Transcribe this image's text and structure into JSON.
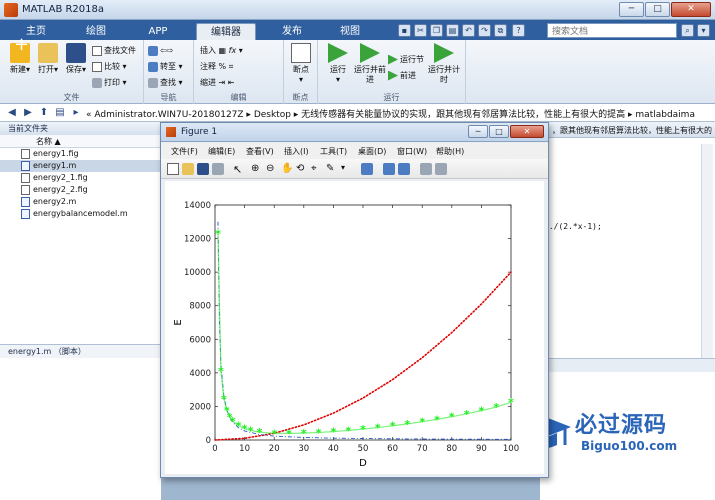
{
  "window": {
    "title": "MATLAB R2018a",
    "controls": {
      "minimize": "─",
      "maximize": "□",
      "close": "✕"
    }
  },
  "ribbon_tabs": [
    "主页",
    "绘图",
    "APP",
    "编辑器",
    "发布",
    "视图"
  ],
  "search": {
    "placeholder": "搜索文档"
  },
  "ribbon": {
    "file_group": {
      "label": "文件",
      "new": "新建",
      "open": "打开",
      "save": "保存",
      "find_files": "查找文件",
      "compare": "比较",
      "print": "打印"
    },
    "nav_group": {
      "label": "导航",
      "goto": "转至",
      "find": "查找"
    },
    "edit_group": {
      "label": "编辑",
      "insert": "插入",
      "comment": "注释",
      "indent": "缩进"
    },
    "breakpoints_group": {
      "label": "断点",
      "breakpoints": "断点"
    },
    "run_group": {
      "label": "运行",
      "run": "运行",
      "run_advance": "运行并前进",
      "run_section": "运行节",
      "advance": "前进",
      "run_time": "运行并计时"
    }
  },
  "address_bar": {
    "path": "«  Administrator.WIN7U-20180127Z  ▸  Desktop  ▸  无线传感器有关能量协议的实现，跟其他现有邻居算法比较，性能上有很大的提高  ▸  matlabdaima"
  },
  "current_folder": {
    "title": "当前文件夹",
    "column_name": "名称 ▲",
    "files": [
      {
        "name": "energy1.fig",
        "type": "fig",
        "selected": false
      },
      {
        "name": "energy1.m",
        "type": "m",
        "selected": true
      },
      {
        "name": "energy2_1.fig",
        "type": "fig",
        "selected": false
      },
      {
        "name": "energy2_2.fig",
        "type": "fig",
        "selected": false
      },
      {
        "name": "energy2.m",
        "type": "m",
        "selected": false
      },
      {
        "name": "energybalancemodel.m",
        "type": "m",
        "selected": false
      }
    ],
    "details_label": "energy1.m  （脚本）"
  },
  "editor": {
    "tab_text": "，跟其他现有邻居算法比较，性能上有很大的",
    "code_fragment": ")./(2.*x-1);"
  },
  "watermark": {
    "title": "必过源码",
    "subtitle": "Biguo100.com"
  },
  "figure": {
    "title": "Figure 1",
    "menus": [
      "文件(F)",
      "编辑(E)",
      "查看(V)",
      "插入(I)",
      "工具(T)",
      "桌面(D)",
      "窗口(W)",
      "帮助(H)"
    ]
  },
  "chart_data": {
    "type": "line",
    "title": "",
    "xlabel": "D",
    "ylabel": "E",
    "xlim": [
      0,
      100
    ],
    "ylim": [
      0,
      14000
    ],
    "xticks": [
      0,
      10,
      20,
      30,
      40,
      50,
      60,
      70,
      80,
      90,
      100
    ],
    "yticks": [
      0,
      2000,
      4000,
      6000,
      8000,
      10000,
      12000,
      14000
    ],
    "grid": false,
    "series": [
      {
        "style": "red dotted",
        "color": "#e00000",
        "x": [
          0,
          10,
          20,
          30,
          40,
          50,
          60,
          70,
          80,
          90,
          100
        ],
        "y": [
          0,
          100,
          400,
          900,
          1600,
          2500,
          3600,
          4900,
          6400,
          8100,
          10000
        ]
      },
      {
        "style": "green asterisk markers",
        "color": "#22ee22",
        "x": [
          1,
          2,
          3,
          4,
          5,
          6,
          8,
          10,
          12,
          15,
          20,
          25,
          30,
          35,
          40,
          45,
          50,
          55,
          60,
          65,
          70,
          75,
          80,
          85,
          90,
          95,
          100
        ],
        "y": [
          12300,
          4100,
          2450,
          1750,
          1380,
          1130,
          850,
          680,
          570,
          470,
          400,
          390,
          410,
          450,
          500,
          570,
          650,
          740,
          850,
          960,
          1090,
          1230,
          1390,
          1560,
          1750,
          1960,
          2250
        ]
      },
      {
        "style": "blue dash-dot",
        "color": "#2255cc",
        "x": [
          1,
          1.5,
          2,
          3,
          4,
          5,
          6,
          8,
          10,
          15,
          20,
          30,
          40,
          60,
          80,
          100
        ],
        "y": [
          13000,
          7000,
          4500,
          2600,
          1800,
          1350,
          1050,
          720,
          540,
          330,
          230,
          150,
          110,
          70,
          50,
          40
        ]
      }
    ]
  }
}
